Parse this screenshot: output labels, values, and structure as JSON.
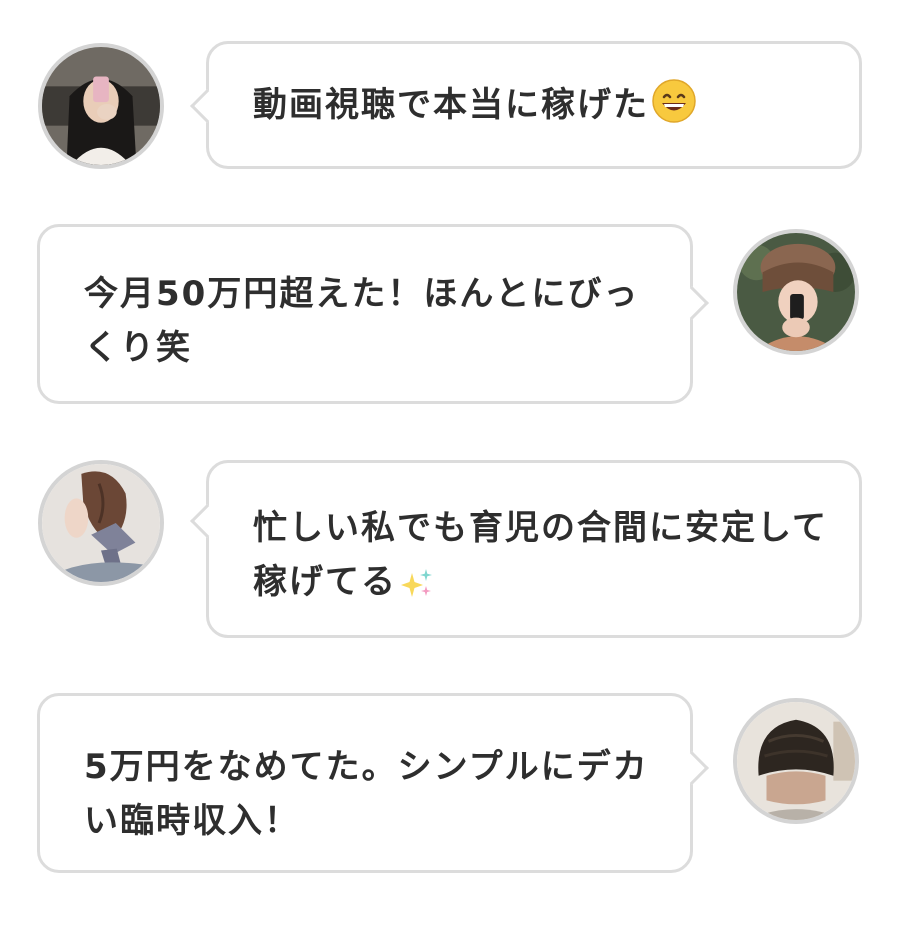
{
  "testimonials": [
    {
      "text": "動画視聴で本当に稼げた",
      "emoji": "grinning-face-icon",
      "side": "left"
    },
    {
      "text": "今月50万円超えた！ほんとにびっくり笑",
      "side": "right"
    },
    {
      "text": "忙しい私でも育児の合間に安定して稼げてる",
      "emoji": "sparkles-icon",
      "side": "left"
    },
    {
      "text": "5万円をなめてた。シンプルにデカい臨時収入！",
      "side": "right"
    }
  ],
  "colors": {
    "bubble_border": "#dcdcdc",
    "avatar_border": "#d4d4d4",
    "text": "#2e2e2e",
    "background": "#ffffff"
  }
}
